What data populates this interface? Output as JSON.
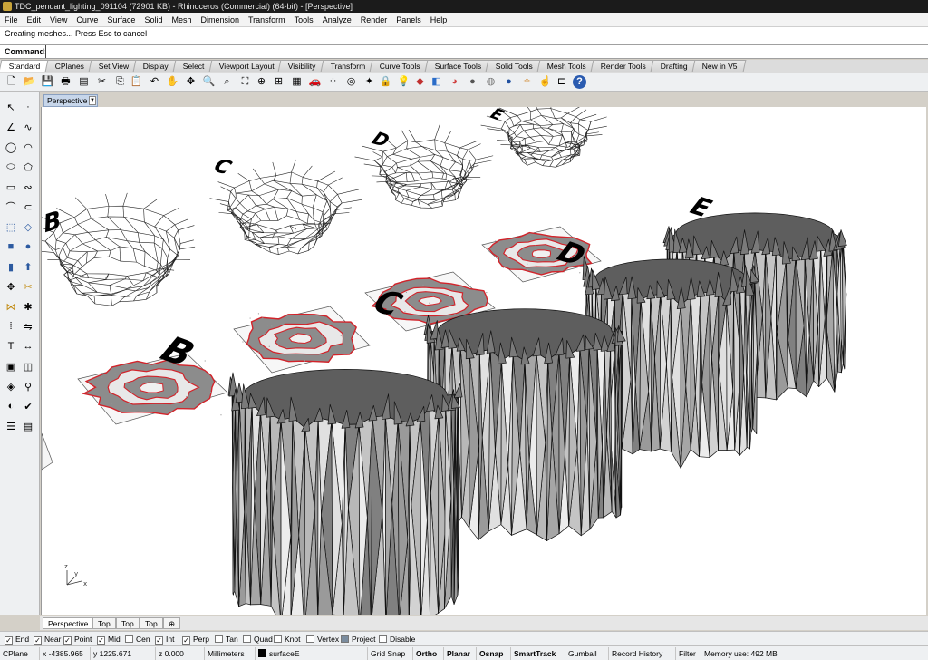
{
  "window": {
    "title": "TDC_pendant_lighting_091104 (72901 KB) - Rhinoceros (Commercial) (64-bit) - [Perspective]"
  },
  "menu": [
    "File",
    "Edit",
    "View",
    "Curve",
    "Surface",
    "Solid",
    "Mesh",
    "Dimension",
    "Transform",
    "Tools",
    "Analyze",
    "Render",
    "Panels",
    "Help"
  ],
  "command": {
    "history": "Creating meshes... Press Esc to cancel",
    "prompt": "Command:",
    "value": ""
  },
  "tabs": [
    {
      "label": "Standard",
      "active": true
    },
    {
      "label": "CPlanes"
    },
    {
      "label": "Set View"
    },
    {
      "label": "Display"
    },
    {
      "label": "Select"
    },
    {
      "label": "Viewport Layout"
    },
    {
      "label": "Visibility"
    },
    {
      "label": "Transform"
    },
    {
      "label": "Curve Tools"
    },
    {
      "label": "Surface Tools"
    },
    {
      "label": "Solid Tools"
    },
    {
      "label": "Mesh Tools"
    },
    {
      "label": "Render Tools"
    },
    {
      "label": "Drafting"
    },
    {
      "label": "New in V5"
    }
  ],
  "toolbar_icons": [
    "new-icon",
    "open-icon",
    "save-icon",
    "print-icon",
    "import-icon",
    "cut-icon",
    "copy-icon",
    "paste-icon",
    "undo-icon",
    "pan-icon",
    "rotate-view-icon",
    "zoom-icon",
    "zoom-window-icon",
    "zoom-extents-icon",
    "zoom-selected-icon",
    "four-viewports-icon",
    "grid-icon",
    "car-icon",
    "select-points-icon",
    "properties-icon",
    "points-on-icon",
    "lock-icon",
    "light-icon",
    "layers-icon",
    "render-material-icon",
    "color-wheel-icon",
    "sphere-icon",
    "ghosted-sphere-icon",
    "render-sphere-icon",
    "raytrace-icon",
    "pointer-icon",
    "snap-icon",
    "gumball-icon",
    "help-icon"
  ],
  "viewport": {
    "label": "Perspective",
    "object_labels": [
      "B",
      "C",
      "D",
      "E",
      "B",
      "C",
      "D",
      "E"
    ],
    "axis_labels": {
      "x": "x",
      "y": "y",
      "z": "z"
    }
  },
  "viewport_tabs": [
    {
      "label": "Perspective",
      "active": true
    },
    {
      "label": "Top"
    },
    {
      "label": "Top"
    },
    {
      "label": "Top"
    }
  ],
  "osnap": [
    {
      "label": "End",
      "checked": true
    },
    {
      "label": "Near",
      "checked": true
    },
    {
      "label": "Point",
      "checked": true
    },
    {
      "label": "Mid",
      "checked": true
    },
    {
      "label": "Cen",
      "checked": false
    },
    {
      "label": "Int",
      "checked": true
    },
    {
      "label": "Perp",
      "checked": true
    },
    {
      "label": "Tan",
      "checked": false
    },
    {
      "label": "Quad",
      "checked": false
    },
    {
      "label": "Knot",
      "checked": false
    },
    {
      "label": "Vertex",
      "checked": false
    },
    {
      "label": "Project",
      "checked": false
    },
    {
      "label": "Disable",
      "checked": false
    }
  ],
  "status": {
    "cplane": "CPlane",
    "x": "x -4385.965",
    "y": "y 1225.671",
    "z": "z 0.000",
    "units": "Millimeters",
    "layer": "surfaceE",
    "grid_snap": "Grid Snap",
    "ortho": "Ortho",
    "planar": "Planar",
    "osnap": "Osnap",
    "smarttrack": "SmartTrack",
    "gumball": "Gumball",
    "record_history": "Record History",
    "filter": "Filter",
    "memory": "Memory use: 492 MB"
  },
  "colors": {
    "accent": "#c7d6ea",
    "mesh_fill": "#8c8c8c",
    "curve_red": "#d2232a",
    "viewport_bg": "#ffffff"
  }
}
